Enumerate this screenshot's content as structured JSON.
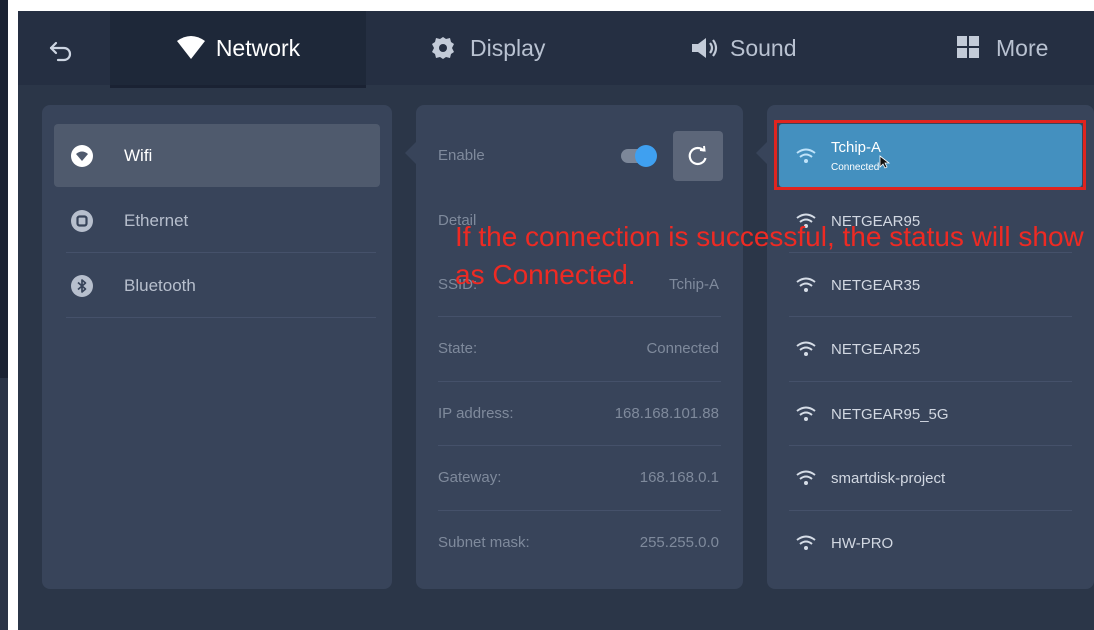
{
  "tabs": [
    {
      "label": "Network",
      "icon": "wifi-icon",
      "active": true
    },
    {
      "label": "Display",
      "icon": "gear-icon",
      "active": false
    },
    {
      "label": "Sound",
      "icon": "speaker-icon",
      "active": false
    },
    {
      "label": "More",
      "icon": "grid-icon",
      "active": false
    }
  ],
  "sidebar": {
    "items": [
      {
        "label": "Wifi",
        "icon": "wifi-circle-icon",
        "selected": true
      },
      {
        "label": "Ethernet",
        "icon": "ethernet-icon",
        "selected": false
      },
      {
        "label": "Bluetooth",
        "icon": "bluetooth-icon",
        "selected": false
      }
    ]
  },
  "details": {
    "enable_label": "Enable",
    "enabled": true,
    "detail_label": "Detail",
    "rows": [
      {
        "label": "SSID:",
        "value": "Tchip-A"
      },
      {
        "label": "State:",
        "value": "Connected"
      },
      {
        "label": "IP address:",
        "value": "168.168.101.88"
      },
      {
        "label": "Gateway:",
        "value": "168.168.0.1"
      },
      {
        "label": "Subnet mask:",
        "value": "255.255.0.0"
      }
    ]
  },
  "networks": [
    {
      "ssid": "Tchip-A",
      "status": "Connected"
    },
    {
      "ssid": "NETGEAR95"
    },
    {
      "ssid": "NETGEAR35"
    },
    {
      "ssid": "NETGEAR25"
    },
    {
      "ssid": "NETGEAR95_5G"
    },
    {
      "ssid": "smartdisk-project"
    },
    {
      "ssid": "HW-PRO"
    }
  ],
  "annotation": {
    "text": "If the connection is successful, the status will show as Connected."
  },
  "colors": {
    "accent": "#3fa0f0",
    "selected_network": "#4490bf",
    "annotation": "#ee2a23",
    "panel": "#38445a",
    "background": "#2b3648"
  }
}
